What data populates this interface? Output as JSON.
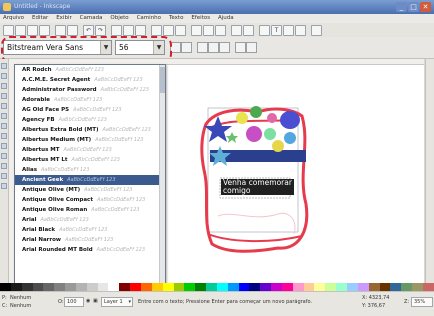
{
  "window": {
    "title": "Untitled - Inkscape"
  },
  "menu": [
    "Arquivo",
    "Editar",
    "Exibir",
    "Camada",
    "Objeto",
    "Caminho",
    "Texto",
    "Efeitos",
    "Ajuda"
  ],
  "text_toolbar": {
    "font_family": "Bitstream Vera Sans",
    "font_size": "56"
  },
  "font_list": [
    {
      "name": "AR Rodch",
      "sample": "AaBbCcDdEeFf 123"
    },
    {
      "name": "A.C.M.E. Secret Agent",
      "sample": "AaBbCcDdEeFf 123"
    },
    {
      "name": "Administrator Password",
      "sample": "AaBbCcDdEeFf 123"
    },
    {
      "name": "Adorable",
      "sample": "AaBbCcDdEeFf 123"
    },
    {
      "name": "AG Old Face PS",
      "sample": "AaBbCcDdEeFf 123"
    },
    {
      "name": "Agency FB",
      "sample": "AaBbCcDdEeFf 123"
    },
    {
      "name": "Albertus Extra Bold (MT)",
      "sample": "AaBbCcDdEeFf 123"
    },
    {
      "name": "Albertus Medium (MT)",
      "sample": "AaBbCcDdEeFf 123"
    },
    {
      "name": "Albertus MT",
      "sample": "AaBbCcDdEeFf 123"
    },
    {
      "name": "Albertus MT Lt",
      "sample": "AaBbCcDdEeFf 123"
    },
    {
      "name": "Alias",
      "sample": "AaBbCcDdEeFf 123"
    },
    {
      "name": "Ancient Geek",
      "sample": "AaBbCcDdEeFf 123"
    },
    {
      "name": "Antique Olive (MT)",
      "sample": "AaBbCcDdEeFf 123"
    },
    {
      "name": "Antique Olive Compact",
      "sample": "AaBbCcDdEeFf 123"
    },
    {
      "name": "Antique Olive Roman",
      "sample": "AaBbCcDdEeFf 123"
    },
    {
      "name": "Arial",
      "sample": "AaBbCcDdEeFf 123"
    },
    {
      "name": "Arial Black",
      "sample": "AaBbCcDdEeFf 123"
    },
    {
      "name": "Arial Narrow",
      "sample": "AaBbCcDdEeFf 123"
    },
    {
      "name": "Arial Rounded MT Bold",
      "sample": "AaBbCcDdEeFf 123"
    }
  ],
  "canvas": {
    "text_line1": "Venha comemorar",
    "text_line2": "comigo"
  },
  "status": {
    "fill_label": "P:",
    "stroke_label": "C:",
    "fill_value": "Nenhum",
    "stroke_value": "Nenhum",
    "opacity_label": "O:",
    "opacity_value": "100",
    "layer": "Layer 1",
    "message": "Entre com o texto; Pressione Enter para começar um novo parágrafo.",
    "coord_x": "X: 4323,74",
    "coord_y": "Y: 376,67",
    "zoom_label": "Z:",
    "zoom": "35%"
  },
  "colors": {
    "highlight": "#d21f2b",
    "selected_font_bg": "#3b5b8f"
  }
}
